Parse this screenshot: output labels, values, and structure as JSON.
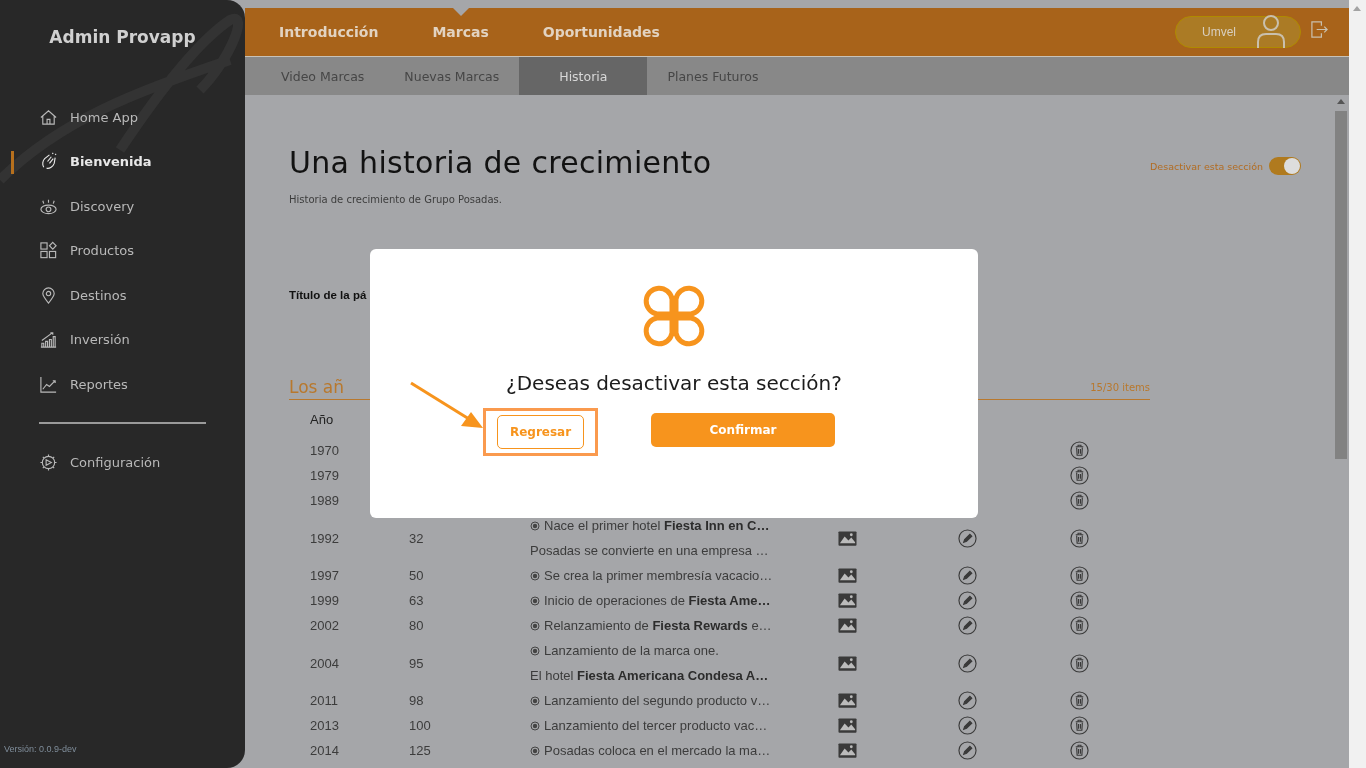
{
  "sidebar": {
    "title": "Admin Provapp",
    "items": [
      {
        "label": "Home App",
        "selected": false
      },
      {
        "label": "Bienvenida",
        "selected": true
      },
      {
        "label": "Discovery",
        "selected": false
      },
      {
        "label": "Productos",
        "selected": false
      },
      {
        "label": "Destinos",
        "selected": false
      },
      {
        "label": "Inversión",
        "selected": false
      },
      {
        "label": "Reportes",
        "selected": false
      }
    ],
    "settings": {
      "label": "Configuración",
      "selected": false
    },
    "version": "Versión: 0.0.9-dev"
  },
  "top_nav": {
    "tabs": [
      {
        "label": "Introducción",
        "selected": false
      },
      {
        "label": "Marcas",
        "selected": true
      },
      {
        "label": "Oportunidades",
        "selected": false
      }
    ],
    "user": "Umvel"
  },
  "sub_tabs": [
    {
      "label": "Video Marcas",
      "selected": false
    },
    {
      "label": "Nuevas Marcas",
      "selected": false
    },
    {
      "label": "Historia",
      "selected": true
    },
    {
      "label": "Planes Futuros",
      "selected": false
    }
  ],
  "page": {
    "title": "Una historia de crecimiento",
    "subtitle": "Historia de crecimiento de Grupo Posadas.",
    "toggle": {
      "label": "Desactivar esta sección",
      "on": true
    },
    "field_label": "Título de la pá",
    "section_title": "Los añ",
    "count": "15/30 items",
    "table": {
      "columns": [
        "Año"
      ],
      "rows": [
        {
          "year": "1970",
          "lines": []
        },
        {
          "year": "1979",
          "lines": []
        },
        {
          "year": "1989",
          "lines": []
        },
        {
          "year": "1992",
          "number": "32",
          "lines": [
            {
              "text": "Nace el primer hotel **Fiesta Inn en C…**",
              "bullet": true
            },
            {
              "text": "Posadas se convierte en una empresa …",
              "bullet": false
            }
          ]
        },
        {
          "year": "1997",
          "number": "50",
          "lines": [
            {
              "text": "Se crea la primer membresía vacacio…",
              "bullet": true
            }
          ]
        },
        {
          "year": "1999",
          "number": "63",
          "lines": [
            {
              "text": "Inicio de operaciones de **Fiesta Ame…**",
              "bullet": true
            }
          ]
        },
        {
          "year": "2002",
          "number": "80",
          "lines": [
            {
              "text": "Relanzamiento de **Fiesta Rewards** e…",
              "bullet": true
            }
          ]
        },
        {
          "year": "2004",
          "number": "95",
          "lines": [
            {
              "text": "Lanzamiento de la marca one.",
              "bullet": true
            },
            {
              "text": "El hotel **Fiesta Americana Condesa A…**",
              "bullet": false
            }
          ]
        },
        {
          "year": "2011",
          "number": "98",
          "lines": [
            {
              "text": "Lanzamiento del segundo producto v…",
              "bullet": true
            }
          ]
        },
        {
          "year": "2013",
          "number": "100",
          "lines": [
            {
              "text": "Lanzamiento del tercer producto vac…",
              "bullet": true
            }
          ]
        },
        {
          "year": "2014",
          "number": "125",
          "lines": [
            {
              "text": "Posadas coloca en el mercado la ma…",
              "bullet": true
            }
          ]
        }
      ]
    }
  },
  "dialog": {
    "question": "¿Deseas desactivar esta sección?",
    "buttons": [
      {
        "label": "Regresar",
        "kind": "outline",
        "highlighted": true
      },
      {
        "label": "Confirmar",
        "kind": "primary",
        "highlighted": false
      }
    ]
  }
}
